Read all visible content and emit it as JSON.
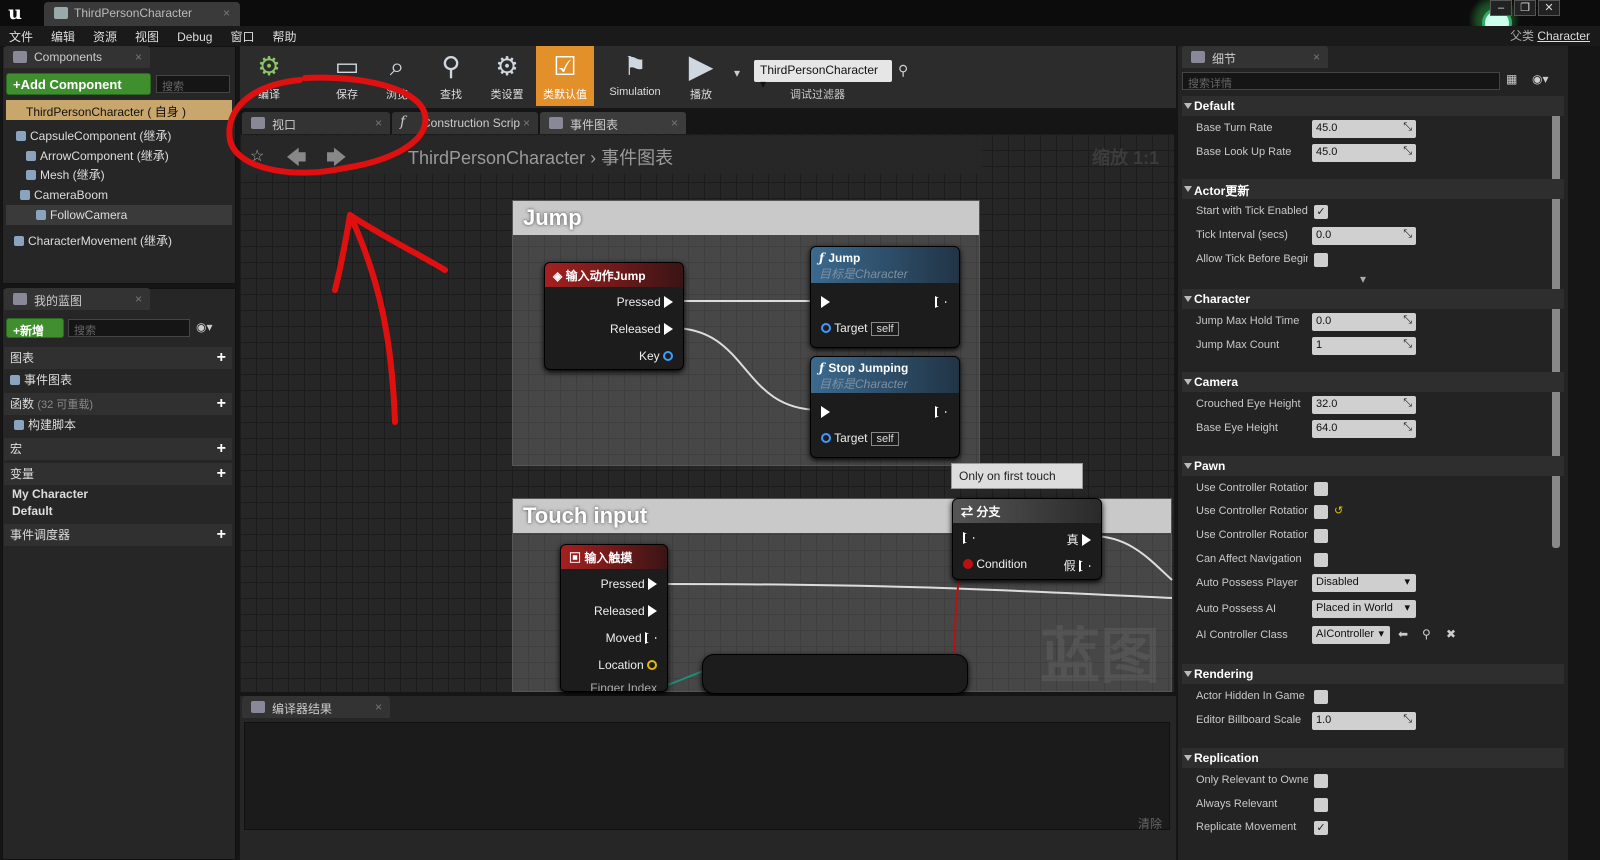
{
  "window": {
    "tab": "ThirdPersonCharacter",
    "parent_label": "父类",
    "parent_class": "Character"
  },
  "menu": [
    "文件",
    "编辑",
    "资源",
    "视图",
    "Debug",
    "窗口",
    "帮助"
  ],
  "components": {
    "tab": "Components",
    "add_button": "+Add Component",
    "search_placeholder": "搜索",
    "root": "ThirdPersonCharacter ( 自身 )",
    "items": [
      "CapsuleComponent (继承)",
      "ArrowComponent (继承)",
      "Mesh (继承)",
      "CameraBoom",
      "FollowCamera",
      "CharacterMovement (继承)"
    ]
  },
  "blueprint": {
    "tab": "我的蓝图",
    "new_button": "+新增",
    "search_placeholder": "搜索",
    "graphs": "图表",
    "event_graph": "事件图表",
    "functions": "函数",
    "functions_note": "(32 可重载)",
    "construction": "构建脚本",
    "macros": "宏",
    "variables": "变量",
    "cat1": "My Character",
    "cat2": "Default",
    "dispatchers": "事件调度器"
  },
  "toolbar": [
    {
      "label": "编译",
      "icon": "compile-icon"
    },
    {
      "label": "保存",
      "icon": "save-icon"
    },
    {
      "label": "浏览",
      "icon": "browse-icon"
    },
    {
      "label": "查找",
      "icon": "find-icon"
    },
    {
      "label": "类设置",
      "icon": "class-settings-icon"
    },
    {
      "label": "类默认值",
      "icon": "class-defaults-icon"
    },
    {
      "label": "Simulation",
      "icon": "simulation-icon"
    },
    {
      "label": "播放",
      "icon": "play-icon"
    }
  ],
  "debug": {
    "selected": "ThirdPersonCharacter",
    "label": "调试过滤器"
  },
  "editor_tabs": [
    "视口",
    "Construction Scrip",
    "事件图表"
  ],
  "graph": {
    "breadcrumb_root": "ThirdPersonCharacter",
    "breadcrumb_leaf": "事件图表",
    "zoom": "缩放 1:1",
    "watermark": "蓝图"
  },
  "nodes": {
    "comment_jump": "Jump",
    "comment_touch": "Touch input",
    "input_jump": "输入动作Jump",
    "pressed": "Pressed",
    "released": "Released",
    "key": "Key",
    "jump_fn": "Jump",
    "target_sub": "目标是Character",
    "target": "Target",
    "self": "self",
    "stop_fn": "Stop Jumping",
    "touch": "输入触摸",
    "moved": "Moved",
    "location": "Location",
    "finger": "Finger Index",
    "branch": "分支",
    "condition": "Condition",
    "true": "真",
    "false": "假",
    "tooltip": "Only on first touch"
  },
  "compiler": {
    "tab": "编译器结果",
    "clear": "清除"
  },
  "details": {
    "tab": "细节",
    "search_placeholder": "搜索详情",
    "sections": {
      "default": "Default",
      "actor": "Actor更新",
      "character": "Character",
      "camera": "Camera",
      "pawn": "Pawn",
      "rendering": "Rendering",
      "replication": "Replication"
    },
    "props": {
      "base_turn": "Base Turn Rate",
      "base_turn_v": "45.0",
      "base_look": "Base Look Up Rate",
      "base_look_v": "45.0",
      "tick_enabled": "Start with Tick Enabled",
      "tick_interval": "Tick Interval (secs)",
      "tick_interval_v": "0.0",
      "allow_tick": "Allow Tick Before Begin",
      "jump_hold": "Jump Max Hold Time",
      "jump_hold_v": "0.0",
      "jump_count": "Jump Max Count",
      "jump_count_v": "1",
      "crouch_eye": "Crouched Eye Height",
      "crouch_eye_v": "32.0",
      "base_eye": "Base Eye Height",
      "base_eye_v": "64.0",
      "ucr1": "Use Controller Rotation",
      "ucr2": "Use Controller Rotation",
      "ucr3": "Use Controller Rotation",
      "can_affect": "Can Affect Navigation",
      "auto_player": "Auto Possess Player",
      "auto_player_v": "Disabled",
      "auto_ai": "Auto Possess AI",
      "auto_ai_v": "Placed in World",
      "ai_class": "AI Controller Class",
      "ai_class_v": "AIController",
      "hidden": "Actor Hidden In Game",
      "billboard": "Editor Billboard Scale",
      "billboard_v": "1.0",
      "only_rel": "Only Relevant to Owner",
      "always_rel": "Always Relevant",
      "rep_move": "Replicate Movement"
    }
  }
}
